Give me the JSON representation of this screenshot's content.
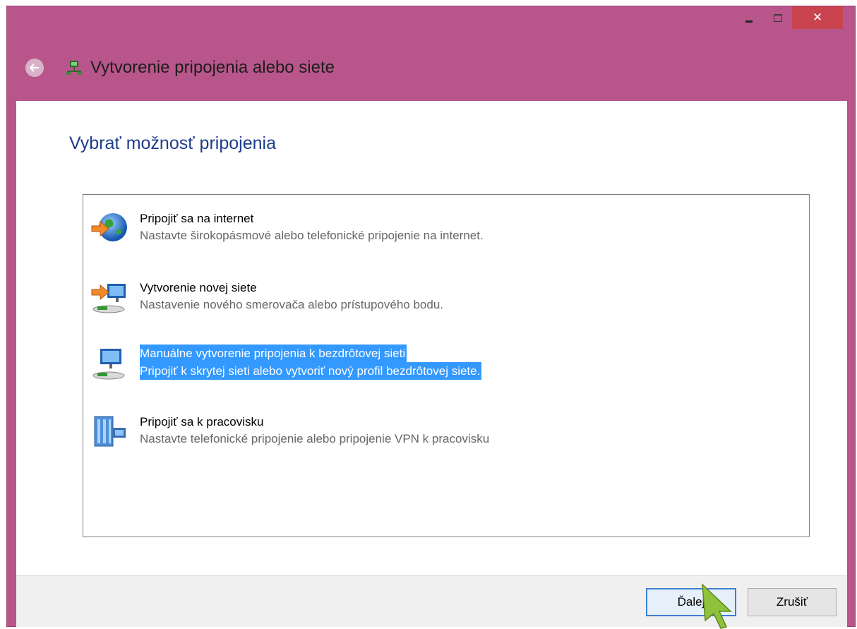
{
  "window": {
    "title": "Vytvorenie pripojenia alebo siete",
    "controls": {
      "minimize": "minimize-icon",
      "maximize": "maximize-icon",
      "close": "✕"
    }
  },
  "page": {
    "heading": "Vybrať možnosť pripojenia"
  },
  "options": [
    {
      "title": "Pripojiť sa na internet",
      "description": "Nastavte širokopásmové alebo telefonické pripojenie na internet.",
      "icon": "globe-connect-icon",
      "selected": false
    },
    {
      "title": "Vytvorenie novej siete",
      "description": "Nastavenie nového smerovača alebo prístupového bodu.",
      "icon": "new-network-icon",
      "selected": false
    },
    {
      "title": "Manuálne vytvorenie pripojenia k bezdrôtovej sieti",
      "description": "Pripojiť k skrytej sieti alebo vytvoriť nový profil bezdrôtovej siete.",
      "icon": "wireless-network-icon",
      "selected": true
    },
    {
      "title": "Pripojiť sa k pracovisku",
      "description": "Nastavte telefonické pripojenie alebo pripojenie VPN k pracovisku",
      "icon": "workplace-icon",
      "selected": false
    }
  ],
  "buttons": {
    "next": "Ďalej",
    "cancel": "Zrušiť"
  },
  "colors": {
    "titlebar": "#b8568b",
    "heading": "#1e3d8c",
    "selection": "#3399ff",
    "close_button": "#c9444f"
  }
}
